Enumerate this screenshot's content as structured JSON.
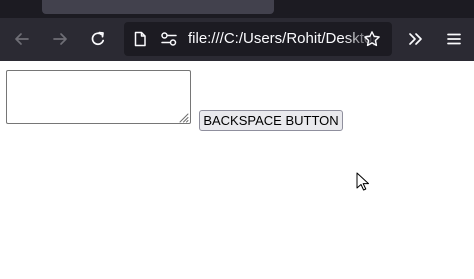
{
  "browser": {
    "address": "file:///C:/Users/Rohit/Desktop"
  },
  "icons": {
    "back": "arrow-left-icon",
    "forward": "arrow-right-icon",
    "reload": "reload-icon",
    "page": "page-icon",
    "permissions": "permissions-icon",
    "bookmark": "star-icon",
    "overflow": "chevrons-right-icon",
    "menu": "hamburger-menu-icon"
  },
  "colors": {
    "tab_strip": "#1c1b22",
    "toolbar": "#2b2a33",
    "url_field": "#1c1b22",
    "button_face": "#e9e9ed"
  },
  "page": {
    "textarea_value": "",
    "button_label": "BACKSPACE BUTTON"
  }
}
